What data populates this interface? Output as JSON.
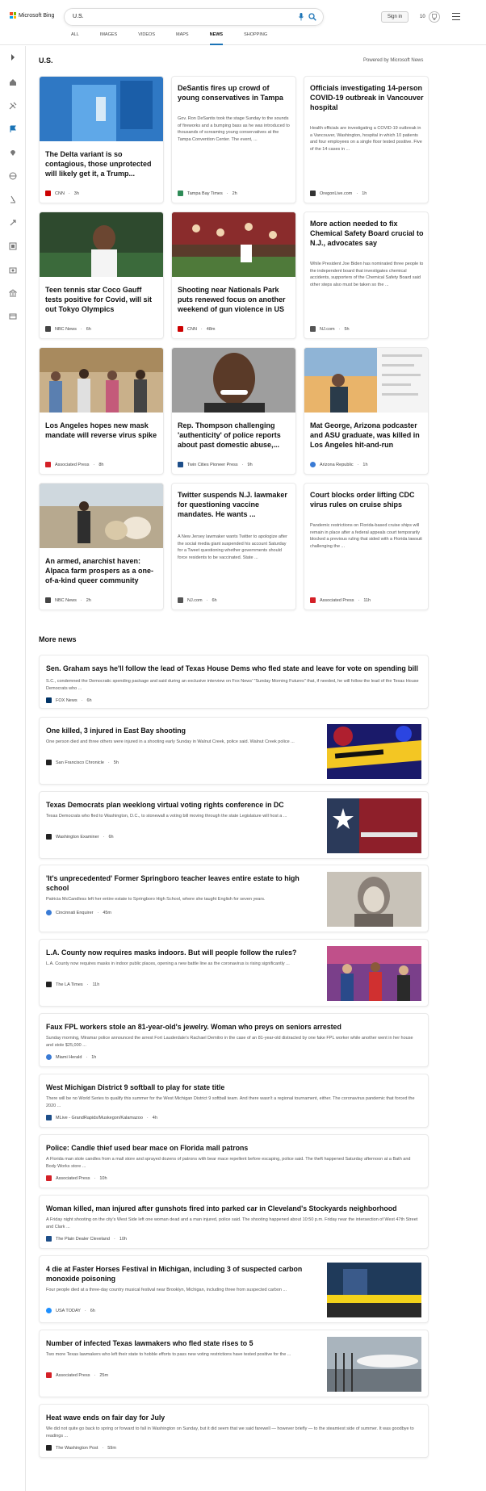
{
  "header": {
    "logo_text": "Microsoft Bing",
    "query": "U.S.",
    "signin_label": "Sign in",
    "rewards_count": "10",
    "tabs": [
      {
        "label": "ALL"
      },
      {
        "label": "IMAGES"
      },
      {
        "label": "VIDEOS"
      },
      {
        "label": "MAPS"
      },
      {
        "label": "NEWS"
      },
      {
        "label": "SHOPPING"
      }
    ],
    "active_tab": "NEWS"
  },
  "rail": {
    "icons": [
      "expand-icon",
      "home-icon",
      "tools-icon",
      "flag-icon",
      "location-icon",
      "globe-icon",
      "microscope-icon",
      "rocket-icon",
      "film-icon",
      "camera-icon",
      "bank-icon",
      "card-icon"
    ]
  },
  "section": {
    "title": "U.S.",
    "powered_by": "Powered by Microsoft News"
  },
  "cards": [
    {
      "title": "The Delta variant is so contagious, those unprotected will likely get it, a Trump...",
      "summary": "",
      "source": "CNN",
      "time": "3h",
      "has_image": true,
      "logo_color": "#cc0000"
    },
    {
      "title": "DeSantis fires up crowd of young conservatives in Tampa",
      "summary": "Gov. Ron DeSantis took the stage Sunday to the sounds of fireworks and a bumping bass as he was introduced to thousands of screaming young conservatives at the Tampa Convention Center. The event, ...",
      "source": "Tampa Bay Times",
      "time": "2h",
      "has_image": false,
      "logo_color": "#2e8b57"
    },
    {
      "title": "Officials investigating 14-person COVID-19 outbreak in Vancouver hospital",
      "summary": "Health officials are investigating a COVID-19 outbreak in a Vancouver, Washington, hospital in which 10 patients and four employees on a single floor tested positive. Five of the 14 cases in ...",
      "source": "OregonLive.com",
      "time": "1h",
      "has_image": false,
      "logo_color": "#333333"
    },
    {
      "title": "Teen tennis star Coco Gauff tests positive for Covid, will sit out Tokyo Olympics",
      "summary": "",
      "source": "NBC News",
      "time": "6h",
      "has_image": true,
      "logo_color": "#444444"
    },
    {
      "title": "Shooting near Nationals Park puts renewed focus on another weekend of gun violence in US",
      "summary": "",
      "source": "CNN",
      "time": "48m",
      "has_image": true,
      "logo_color": "#cc0000"
    },
    {
      "title": "More action needed to fix Chemical Safety Board crucial to N.J., advocates say",
      "summary": "While President Joe Biden has nominated three people to the independent board that investigates chemical accidents, supporters of the Chemical Safety Board said other steps also must be taken so the ...",
      "source": "NJ.com",
      "time": "5h",
      "has_image": false,
      "logo_color": "#555555"
    },
    {
      "title": "Los Angeles hopes new mask mandate will reverse virus spike",
      "summary": "",
      "source": "Associated Press",
      "time": "8h",
      "has_image": true,
      "logo_color": "#d42027"
    },
    {
      "title": "Rep. Thompson challenging 'authenticity' of police reports about past domestic abuse,...",
      "summary": "",
      "source": "Twin Cities Pioneer Press",
      "time": "9h",
      "has_image": true,
      "logo_color": "#1d4e89"
    },
    {
      "title": "Mat George, Arizona podcaster and ASU graduate, was killed in Los Angeles hit-and-run",
      "summary": "",
      "source": "Arizona Republic",
      "time": "1h",
      "has_image": true,
      "logo_color": "#3a7bd5"
    },
    {
      "title": "An armed, anarchist haven: Alpaca farm prospers as a one-of-a-kind queer community",
      "summary": "",
      "source": "NBC News",
      "time": "2h",
      "has_image": true,
      "logo_color": "#444444"
    },
    {
      "title": "Twitter suspends N.J. lawmaker for questioning vaccine mandates. He wants ...",
      "summary": "A New Jersey lawmaker wants Twitter to apologize after the social media giant suspended his account Saturday for a Tweet questioning whether governments should force residents to be vaccinated. State ...",
      "source": "NJ.com",
      "time": "6h",
      "has_image": false,
      "logo_color": "#555555"
    },
    {
      "title": "Court blocks order lifting CDC virus rules on cruise ships",
      "summary": "Pandemic restrictions on Florida-based cruise ships will remain in place after a federal appeals court temporarily blocked a previous ruling that sided with a Florida lawsuit challenging the ...",
      "source": "Associated Press",
      "time": "11h",
      "has_image": false,
      "logo_color": "#d42027"
    }
  ],
  "more_news": {
    "title": "More news",
    "items": [
      {
        "title": "Sen. Graham says he'll follow the lead of Texas House Dems who fled state and leave for vote on spending bill",
        "summary": "S.C., condemned the Democratic spending package and said during an exclusive interview on Fox News' \"Sunday Morning Futures\" that, if needed, he will follow the lead of the Texas House Democrats who ...",
        "source": "FOX News",
        "time": "6h",
        "has_image": false,
        "logo_color": "#003366"
      },
      {
        "title": "One killed, 3 injured in East Bay shooting",
        "summary": "One person died and three others were injured in a shooting early Sunday in Walnut Creek, police said. Walnut Creek police ...",
        "source": "San Francisco Chronicle",
        "time": "5h",
        "has_image": true,
        "logo_color": "#222222"
      },
      {
        "title": "Texas Democrats plan weeklong virtual voting rights conference in DC",
        "summary": "Texas Democrats who fled to Washington, D.C., to stonewall a voting bill moving through the state Legislature will host a ...",
        "source": "Washington Examiner",
        "time": "6h",
        "has_image": true,
        "logo_color": "#222222"
      },
      {
        "title": "'It's unprecedented' Former Springboro teacher leaves entire estate to high school",
        "summary": "Patricia McCandless left her entire estate to Springboro High School, where she taught English for seven years.",
        "source": "Cincinnati Enquirer",
        "time": "45m",
        "has_image": true,
        "logo_color": "#3a7bd5"
      },
      {
        "title": "L.A. County now requires masks indoors. But will people follow the rules?",
        "summary": "L.A. County now requires masks in indoor public places, opening a new battle line as the coronavirus is rising significantly ...",
        "source": "The LA Times",
        "time": "11h",
        "has_image": true,
        "logo_color": "#222222"
      },
      {
        "title": "Faux FPL workers stole an 81-year-old's jewelry. Woman who preys on seniors arrested",
        "summary": "Sunday morning, Miramar police announced the arrest Fort Lauderdale's Rachael Demitro in the case of an 81-year-old distracted by one fake FPL worker while another went in her house and stole $25,000 ...",
        "source": "Miami Herald",
        "time": "1h",
        "has_image": false,
        "logo_color": "#3a7bd5"
      },
      {
        "title": "West Michigan District 9 softball to play for state title",
        "summary": "There will be no World Series to qualify this summer for the West Michigan District 9 softball team. And there wasn't a regional tournament, either. The coronavirus pandemic that forced the 2020 ...",
        "source": "MLive - GrandRapids/Muskegon/Kalamazoo",
        "time": "4h",
        "has_image": false,
        "logo_color": "#1d4e89"
      },
      {
        "title": "Police: Candle thief used bear mace on Florida mall patrons",
        "summary": "A Florida man stole candles from a mall store and sprayed dozens of patrons with bear mace repellent before escaping, police said. The theft happened Saturday afternoon at a Bath and Body Works store ...",
        "source": "Associated Press",
        "time": "10h",
        "has_image": false,
        "logo_color": "#d42027"
      },
      {
        "title": "Woman killed, man injured after gunshots fired into parked car in Cleveland's Stockyards neighborhood",
        "summary": "A Friday night shooting on the city's West Side left one woman dead and a man injured, police said. The shooting happened about 10:50 p.m. Friday near the intersection of West 47th Street and Clark ...",
        "source": "The Plain Dealer Cleveland",
        "time": "10h",
        "has_image": false,
        "logo_color": "#1d4e89"
      },
      {
        "title": "4 die at Faster Horses Festival in Michigan, including 3 of suspected carbon monoxide poisoning",
        "summary": "Four people died at a three-day country musical festival near Brooklyn, Michigan, including three from suspected carbon ...",
        "source": "USA TODAY",
        "time": "6h",
        "has_image": true,
        "logo_color": "#1e90ff"
      },
      {
        "title": "Number of infected Texas lawmakers who fled state rises to 5",
        "summary": "Two more Texas lawmakers who left their state to hobble efforts to pass new voting restrictions have tested positive for the ...",
        "source": "Associated Press",
        "time": "25m",
        "has_image": true,
        "logo_color": "#d42027"
      },
      {
        "title": "Heat wave ends on fair day for July",
        "summary": "We did not quite go back to spring or forward to fall in Washington on Sunday, but it did seem that we said farewell — however briefly — to the steamiest side of summer. It was goodbye to readings ...",
        "source": "The Washington Post",
        "time": "59m",
        "has_image": false,
        "logo_color": "#222222"
      }
    ]
  },
  "colors": {
    "accent": "#1a73b6",
    "card_border": "#eaeaea",
    "text_muted": "#555555"
  }
}
